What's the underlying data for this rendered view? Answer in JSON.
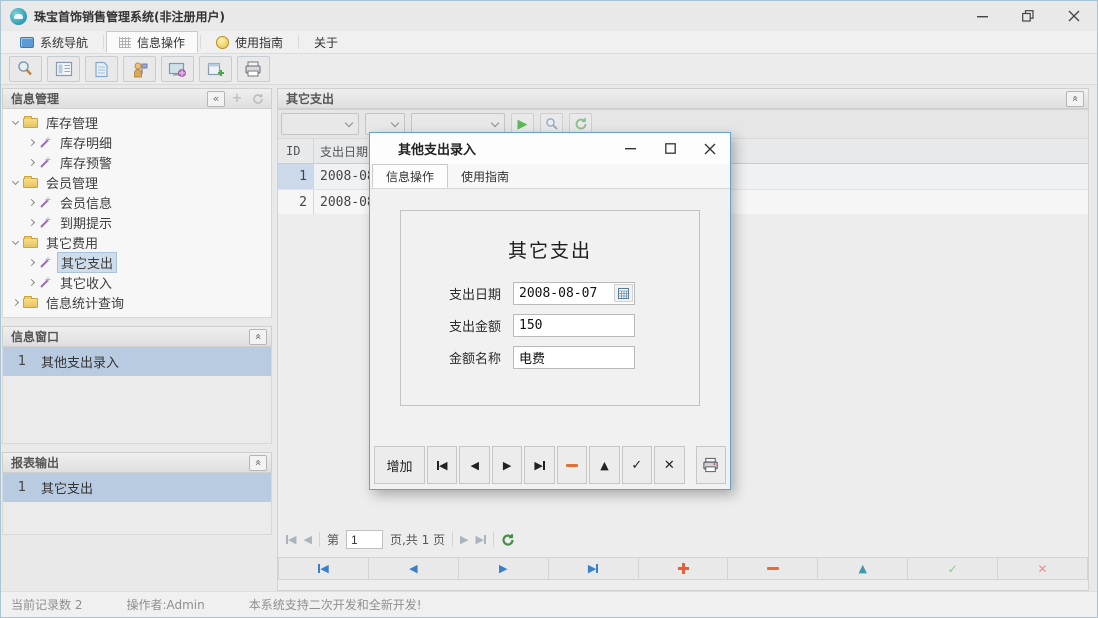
{
  "colors": {
    "selection_blue": "#b9cbe0",
    "tree_selection": "#cfdcea",
    "accent_blue": "#3d7fc4",
    "play_green": "#5cb85c"
  },
  "window": {
    "title": "珠宝首饰销售管理系统(非注册用户)"
  },
  "menu": {
    "items": [
      {
        "label": "系统导航",
        "icon": "monitor-icon"
      },
      {
        "label": "信息操作",
        "icon": "grid-icon",
        "active": true
      },
      {
        "label": "使用指南",
        "icon": "clock-icon"
      },
      {
        "label": "关于",
        "icon": ""
      }
    ]
  },
  "toolbar": {
    "icons": [
      "search-icon",
      "table-icon",
      "document-icon",
      "user-flag-icon",
      "monitor-globe-icon",
      "window-add-icon",
      "printer-icon"
    ]
  },
  "sidebar": {
    "info_panel": {
      "title": "信息管理"
    },
    "tree": [
      {
        "label": "库存管理"
      },
      {
        "label": "库存明细"
      },
      {
        "label": "库存预警"
      },
      {
        "label": "会员管理"
      },
      {
        "label": "会员信息"
      },
      {
        "label": "到期提示"
      },
      {
        "label": "其它费用"
      },
      {
        "label": "其它支出"
      },
      {
        "label": "其它收入"
      },
      {
        "label": "信息统计查询"
      }
    ],
    "info_window_panel": {
      "title": "信息窗口",
      "rows": [
        {
          "index": "1",
          "label": "其他支出录入"
        }
      ]
    },
    "report_panel": {
      "title": "报表输出",
      "rows": [
        {
          "index": "1",
          "label": "其它支出"
        }
      ]
    }
  },
  "main": {
    "panel_title": "其它支出",
    "grid": {
      "columns": [
        "ID",
        "支出日期"
      ],
      "rows": [
        {
          "id": "1",
          "date": "2008-08-"
        },
        {
          "id": "2",
          "date": "2008-08-"
        }
      ]
    },
    "pager": {
      "prefix": "第",
      "page": "1",
      "suffix": "页,共 1 页"
    }
  },
  "dialog": {
    "title": "其他支出录入",
    "tabs": [
      {
        "label": "信息操作",
        "active": true
      },
      {
        "label": "使用指南"
      }
    ],
    "group_title": "其它支出",
    "fields": [
      {
        "label": "支出日期",
        "value": "2008-08-07"
      },
      {
        "label": "支出金额",
        "value": "150"
      },
      {
        "label": "金额名称",
        "value": "电费"
      }
    ],
    "buttons": {
      "add": "增加"
    }
  },
  "statusbar": {
    "record_count": "当前记录数 2",
    "operator": "操作者:Admin",
    "message": "本系统支持二次开发和全新开发!"
  }
}
